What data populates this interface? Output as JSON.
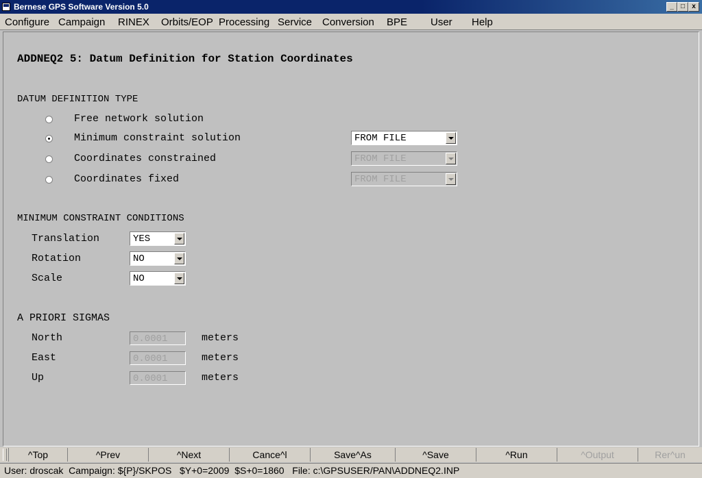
{
  "window": {
    "title": "Bernese GPS Software Version 5.0",
    "minimize": "_",
    "maximize": "□",
    "close": "x"
  },
  "menu": [
    "Configure",
    "Campaign",
    "RINEX",
    "Orbits/EOP",
    "Processing",
    "Service",
    "Conversion",
    "BPE",
    "User",
    "Help"
  ],
  "form": {
    "heading": "ADDNEQ2 5: Datum Definition for Station Coordinates",
    "datum_section": "DATUM DEFINITION TYPE",
    "datum_options": [
      {
        "label": "Free network solution",
        "selected": false
      },
      {
        "label": "Minimum constraint solution",
        "selected": true,
        "value": "FROM FILE"
      },
      {
        "label": "Coordinates constrained",
        "selected": false,
        "value": "FROM FILE"
      },
      {
        "label": "Coordinates fixed",
        "selected": false,
        "value": "FROM FILE"
      }
    ],
    "mc_section": "MINIMUM CONSTRAINT CONDITIONS",
    "mc_rows": [
      {
        "label": "Translation",
        "value": "YES"
      },
      {
        "label": "Rotation",
        "value": "NO"
      },
      {
        "label": "Scale",
        "value": "NO"
      }
    ],
    "sigma_section": "A PRIORI SIGMAS",
    "sigma_rows": [
      {
        "label": "North",
        "value": "0.0001",
        "unit": "meters"
      },
      {
        "label": "East",
        "value": "0.0001",
        "unit": "meters"
      },
      {
        "label": "Up",
        "value": "0.0001",
        "unit": "meters"
      }
    ]
  },
  "buttons": [
    {
      "label": "^Top",
      "enabled": true
    },
    {
      "label": "^Prev",
      "enabled": true
    },
    {
      "label": "^Next",
      "enabled": true
    },
    {
      "label": "Cance^l",
      "enabled": true
    },
    {
      "label": "Save^As",
      "enabled": true
    },
    {
      "label": "^Save",
      "enabled": true
    },
    {
      "label": "^Run",
      "enabled": true
    },
    {
      "label": "^Output",
      "enabled": false
    },
    {
      "label": "Rer^un",
      "enabled": false
    }
  ],
  "status": "User: droscak  Campaign: ${P}/SKPOS   $Y+0=2009  $S+0=1860   File: c:\\GPSUSER/PAN\\ADDNEQ2.INP"
}
